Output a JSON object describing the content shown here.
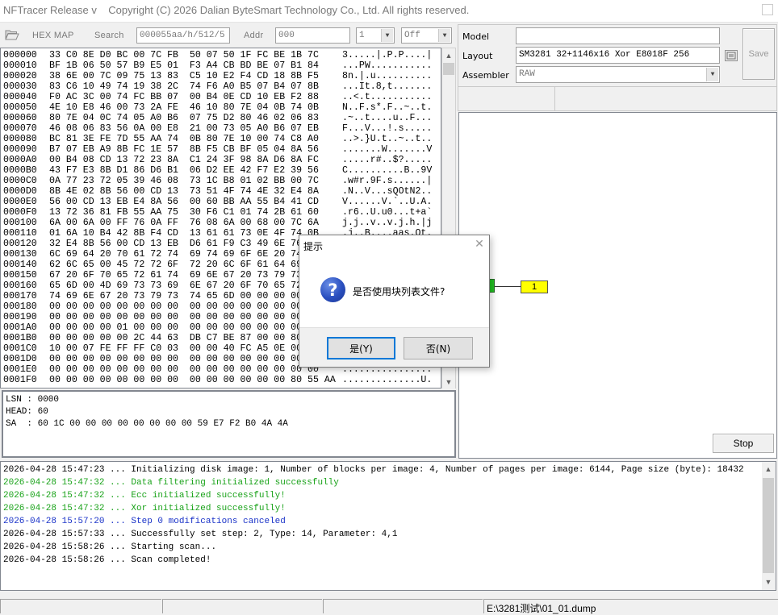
{
  "window": {
    "app_name": "NFTracer Release v",
    "copyright": "Copyright (C) 2026 Dalian ByteSmart Technology Co., Ltd. All rights reserved."
  },
  "toolbar": {
    "open_icon": "folder-open-icon",
    "hex_map_label": "HEX MAP",
    "search_label": "Search",
    "search_value": "000055aa/h/512/5",
    "addr_label": "Addr",
    "addr_value": "000",
    "step_value": "1",
    "mode_value": "Off"
  },
  "hex_view": {
    "rows": [
      {
        "offset": "000000",
        "hex": "33 C0 8E D0 BC 00 7C FB  50 07 50 1F FC BE 1B 7C",
        "ascii": "3.....|.P.P....|"
      },
      {
        "offset": "000010",
        "hex": "BF 1B 06 50 57 B9 E5 01  F3 A4 CB BD BE 07 B1 84",
        "ascii": "...PW..........."
      },
      {
        "offset": "000020",
        "hex": "38 6E 00 7C 09 75 13 83  C5 10 E2 F4 CD 18 8B F5",
        "ascii": "8n.|.u.........."
      },
      {
        "offset": "000030",
        "hex": "83 C6 10 49 74 19 38 2C  74 F6 A0 B5 07 B4 07 8B",
        "ascii": "...It.8,t......."
      },
      {
        "offset": "000040",
        "hex": "F0 AC 3C 00 74 FC BB 07  00 B4 0E CD 10 EB F2 88",
        "ascii": "..<.t..........."
      },
      {
        "offset": "000050",
        "hex": "4E 10 E8 46 00 73 2A FE  46 10 80 7E 04 0B 74 0B",
        "ascii": "N..F.s*.F..~..t."
      },
      {
        "offset": "000060",
        "hex": "80 7E 04 0C 74 05 A0 B6  07 75 D2 80 46 02 06 83",
        "ascii": ".~..t....u..F..."
      },
      {
        "offset": "000070",
        "hex": "46 08 06 83 56 0A 00 E8  21 00 73 05 A0 B6 07 EB",
        "ascii": "F...V...!.s....."
      },
      {
        "offset": "000080",
        "hex": "BC 81 3E FE 7D 55 AA 74  0B 80 7E 10 00 74 C8 A0",
        "ascii": "..>.}U.t..~..t.."
      },
      {
        "offset": "000090",
        "hex": "B7 07 EB A9 8B FC 1E 57  8B F5 CB BF 05 04 8A 56",
        "ascii": ".......W.......V"
      },
      {
        "offset": "0000A0",
        "hex": "00 B4 08 CD 13 72 23 8A  C1 24 3F 98 8A D6 8A FC",
        "ascii": ".....r#..$?....."
      },
      {
        "offset": "0000B0",
        "hex": "43 F7 E3 8B D1 86 D6 B1  06 D2 EE 42 F7 E2 39 56",
        "ascii": "C..........B..9V"
      },
      {
        "offset": "0000C0",
        "hex": "0A 77 23 72 05 39 46 08  73 1C B8 01 02 BB 00 7C",
        "ascii": ".w#r.9F.s......|"
      },
      {
        "offset": "0000D0",
        "hex": "8B 4E 02 8B 56 00 CD 13  73 51 4F 74 4E 32 E4 8A",
        "ascii": ".N..V...sQOtN2.."
      },
      {
        "offset": "0000E0",
        "hex": "56 00 CD 13 EB E4 8A 56  00 60 BB AA 55 B4 41 CD",
        "ascii": "V......V.`..U.A."
      },
      {
        "offset": "0000F0",
        "hex": "13 72 36 81 FB 55 AA 75  30 F6 C1 01 74 2B 61 60",
        "ascii": ".r6..U.u0...t+a`"
      },
      {
        "offset": "000100",
        "hex": "6A 00 6A 00 FF 76 0A FF  76 08 6A 00 68 00 7C 6A",
        "ascii": "j.j..v..v.j.h.|j"
      },
      {
        "offset": "000110",
        "hex": "01 6A 10 B4 42 8B F4 CD  13 61 61 73 0E 4F 74 0B",
        "ascii": ".j..B....aas.Ot."
      },
      {
        "offset": "000120",
        "hex": "32 E4 8B 56 00 CD 13 EB  D6 61 F9 C3 49 6E 76 61",
        "ascii": "2..V.....a..Inva"
      },
      {
        "offset": "000130",
        "hex": "6C 69 64 20 70 61 72 74  69 74 69 6F 6E 20 74 61",
        "ascii": "lid partition ta"
      },
      {
        "offset": "000140",
        "hex": "62 6C 65 00 45 72 72 6F  72 20 6C 6F 61 64 69 6E",
        "ascii": "ble.Error loadin"
      },
      {
        "offset": "000150",
        "hex": "67 20 6F 70 65 72 61 74  69 6E 67 20 73 79 73 74",
        "ascii": "g operating syst"
      },
      {
        "offset": "000160",
        "hex": "65 6D 00 4D 69 73 73 69  6E 67 20 6F 70 65 72 61",
        "ascii": "em.Missing opera"
      },
      {
        "offset": "000170",
        "hex": "74 69 6E 67 20 73 79 73  74 65 6D 00 00 00 00 00",
        "ascii": "ting system....."
      },
      {
        "offset": "000180",
        "hex": "00 00 00 00 00 00 00 00  00 00 00 00 00 00 00 00",
        "ascii": "................"
      },
      {
        "offset": "000190",
        "hex": "00 00 00 00 00 00 00 00  00 00 00 00 00 00 00 00",
        "ascii": "................"
      },
      {
        "offset": "0001A0",
        "hex": "00 00 00 00 01 00 00 00  00 00 00 00 00 00 00 00",
        "ascii": "................"
      },
      {
        "offset": "0001B0",
        "hex": "00 00 00 00 00 2C 44 63  DB C7 BE 87 00 00 80 20",
        "ascii": ".....,Dc....... "
      },
      {
        "offset": "0001C0",
        "hex": "10 00 07 FE FF FF C0 03  00 00 40 FC A5 0E 00 00",
        "ascii": "..........@....."
      },
      {
        "offset": "0001D0",
        "hex": "00 00 00 00 00 00 00 00  00 00 00 00 00 00 00 00",
        "ascii": "................"
      },
      {
        "offset": "0001E0",
        "hex": "00 00 00 00 00 00 00 00  00 00 00 00 00 00 00 00",
        "ascii": "................"
      },
      {
        "offset": "0001F0",
        "hex": "00 00 00 00 00 00 00 00  00 00 00 00 00 00 80 55 AA",
        "ascii": "..............U."
      }
    ]
  },
  "info": {
    "lsn": "LSN : 0000",
    "head": "HEAD: 60",
    "sa": "SA  : 60 1C 00 00 00 00 00 00 00 00 59 E7 F2 B0 4A 4A"
  },
  "right_panel": {
    "model_label": "Model",
    "model_value": "",
    "layout_label": "Layout",
    "layout_value": "SM3281 32+1146x16 Xor E8018F 256",
    "assembler_label": "Assembler",
    "assembler_value": "RAW",
    "save_label": "Save",
    "stop_label": "Stop",
    "graph_node_label": "1"
  },
  "log": [
    {
      "text": "2026-04-28 15:47:23 ... Initializing disk image: 1, Number of blocks per image: 4, Number of pages per image: 6144, Page size (byte): 18432",
      "color": "#000000"
    },
    {
      "text": "2026-04-28 15:47:32 ... Data filtering initialized successfully",
      "color": "#1aa31a"
    },
    {
      "text": "2026-04-28 15:47:32 ... Ecc initialized successfully!",
      "color": "#1aa31a"
    },
    {
      "text": "2026-04-28 15:47:32 ... Xor initialized successfully!",
      "color": "#1aa31a"
    },
    {
      "text": "2026-04-28 15:57:20 ... Step 0 modifications canceled",
      "color": "#1a33c8"
    },
    {
      "text": "2026-04-28 15:57:33 ... Successfully set step: 2, Type: 14, Parameter: 4,1",
      "color": "#000000"
    },
    {
      "text": "2026-04-28 15:58:26 ... Starting scan...",
      "color": "#000000"
    },
    {
      "text": "2026-04-28 15:58:26 ... Scan completed!",
      "color": "#000000"
    }
  ],
  "statusbar": {
    "file_path": "E:\\3281测试\\01_01.dump"
  },
  "dialog": {
    "title": "提示",
    "message": "是否使用块列表文件?",
    "icon": "question-icon",
    "yes_label": "是(Y)",
    "no_label": "否(N)"
  },
  "colors": {
    "graph_node_fill": "#ffff00",
    "graph_port_fill": "#20c020",
    "dialog_icon": "#2a4fbf"
  }
}
